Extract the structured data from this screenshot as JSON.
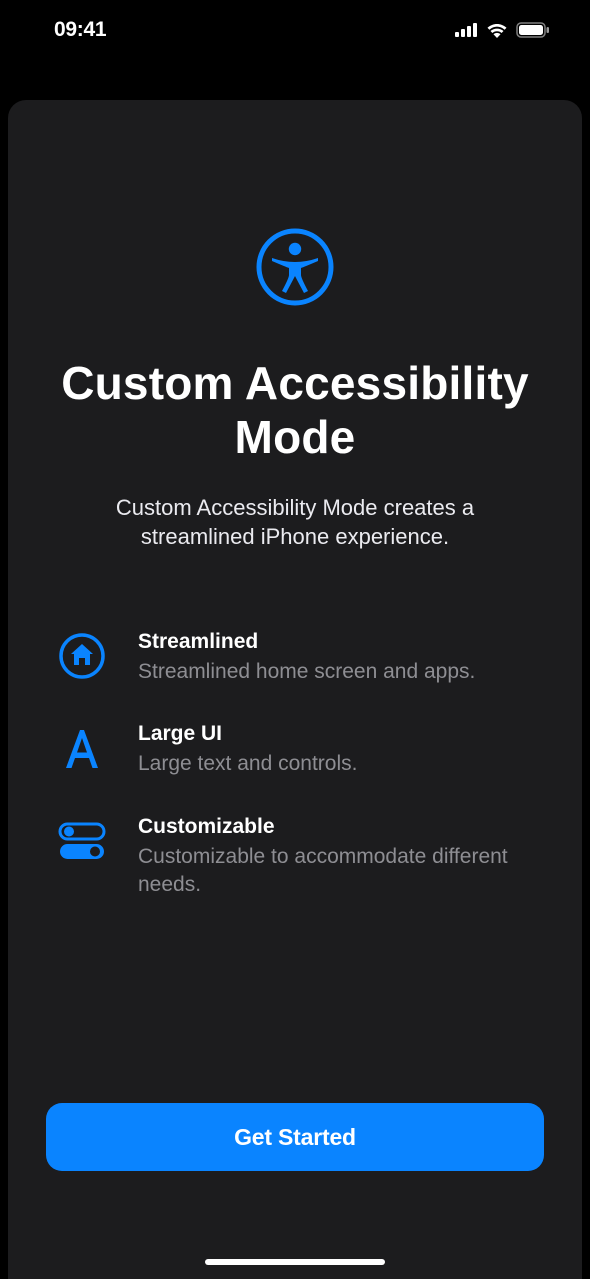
{
  "status_bar": {
    "time": "09:41"
  },
  "hero": {
    "title": "Custom Accessibility Mode",
    "subtitle": "Custom Accessibility Mode creates a streamlined iPhone experience."
  },
  "features": [
    {
      "icon": "home-circle-icon",
      "title": "Streamlined",
      "desc": "Streamlined home screen and apps."
    },
    {
      "icon": "letter-a-icon",
      "title": "Large UI",
      "desc": "Large text and controls."
    },
    {
      "icon": "toggles-icon",
      "title": "Customizable",
      "desc": "Customizable to accommodate different needs."
    }
  ],
  "cta": {
    "label": "Get Started"
  }
}
